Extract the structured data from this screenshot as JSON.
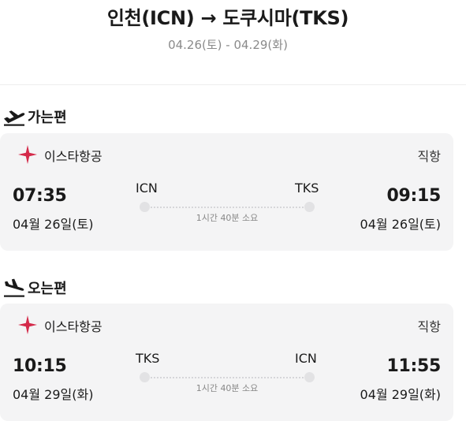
{
  "header": {
    "route": "인천(ICN) → 도쿠시마(TKS)",
    "date_range": "04.26(토) - 04.29(화)"
  },
  "outbound": {
    "section_label": "가는편",
    "section_icon": "airplane-takeoff-icon",
    "airline_logo": "eastar-jet-logo",
    "airline": "이스타항공",
    "flight_type": "직항",
    "dep_time": "07:35",
    "dep_date": "04월 26일(토)",
    "dep_code": "ICN",
    "arr_code": "TKS",
    "arr_time": "09:15",
    "arr_date": "04월 26일(토)",
    "duration": "1시간 40분 소요"
  },
  "inbound": {
    "section_label": "오는편",
    "section_icon": "airplane-landing-icon",
    "airline_logo": "eastar-jet-logo",
    "airline": "이스타항공",
    "flight_type": "직항",
    "dep_time": "10:15",
    "dep_date": "04월 29일(화)",
    "dep_code": "TKS",
    "arr_code": "ICN",
    "arr_time": "11:55",
    "arr_date": "04월 29일(화)",
    "duration": "1시간 40분 소요"
  },
  "colors": {
    "card_background": "#f4f4f5",
    "brand_logo": "#d42a4a",
    "muted_text": "#8a8a8a"
  }
}
